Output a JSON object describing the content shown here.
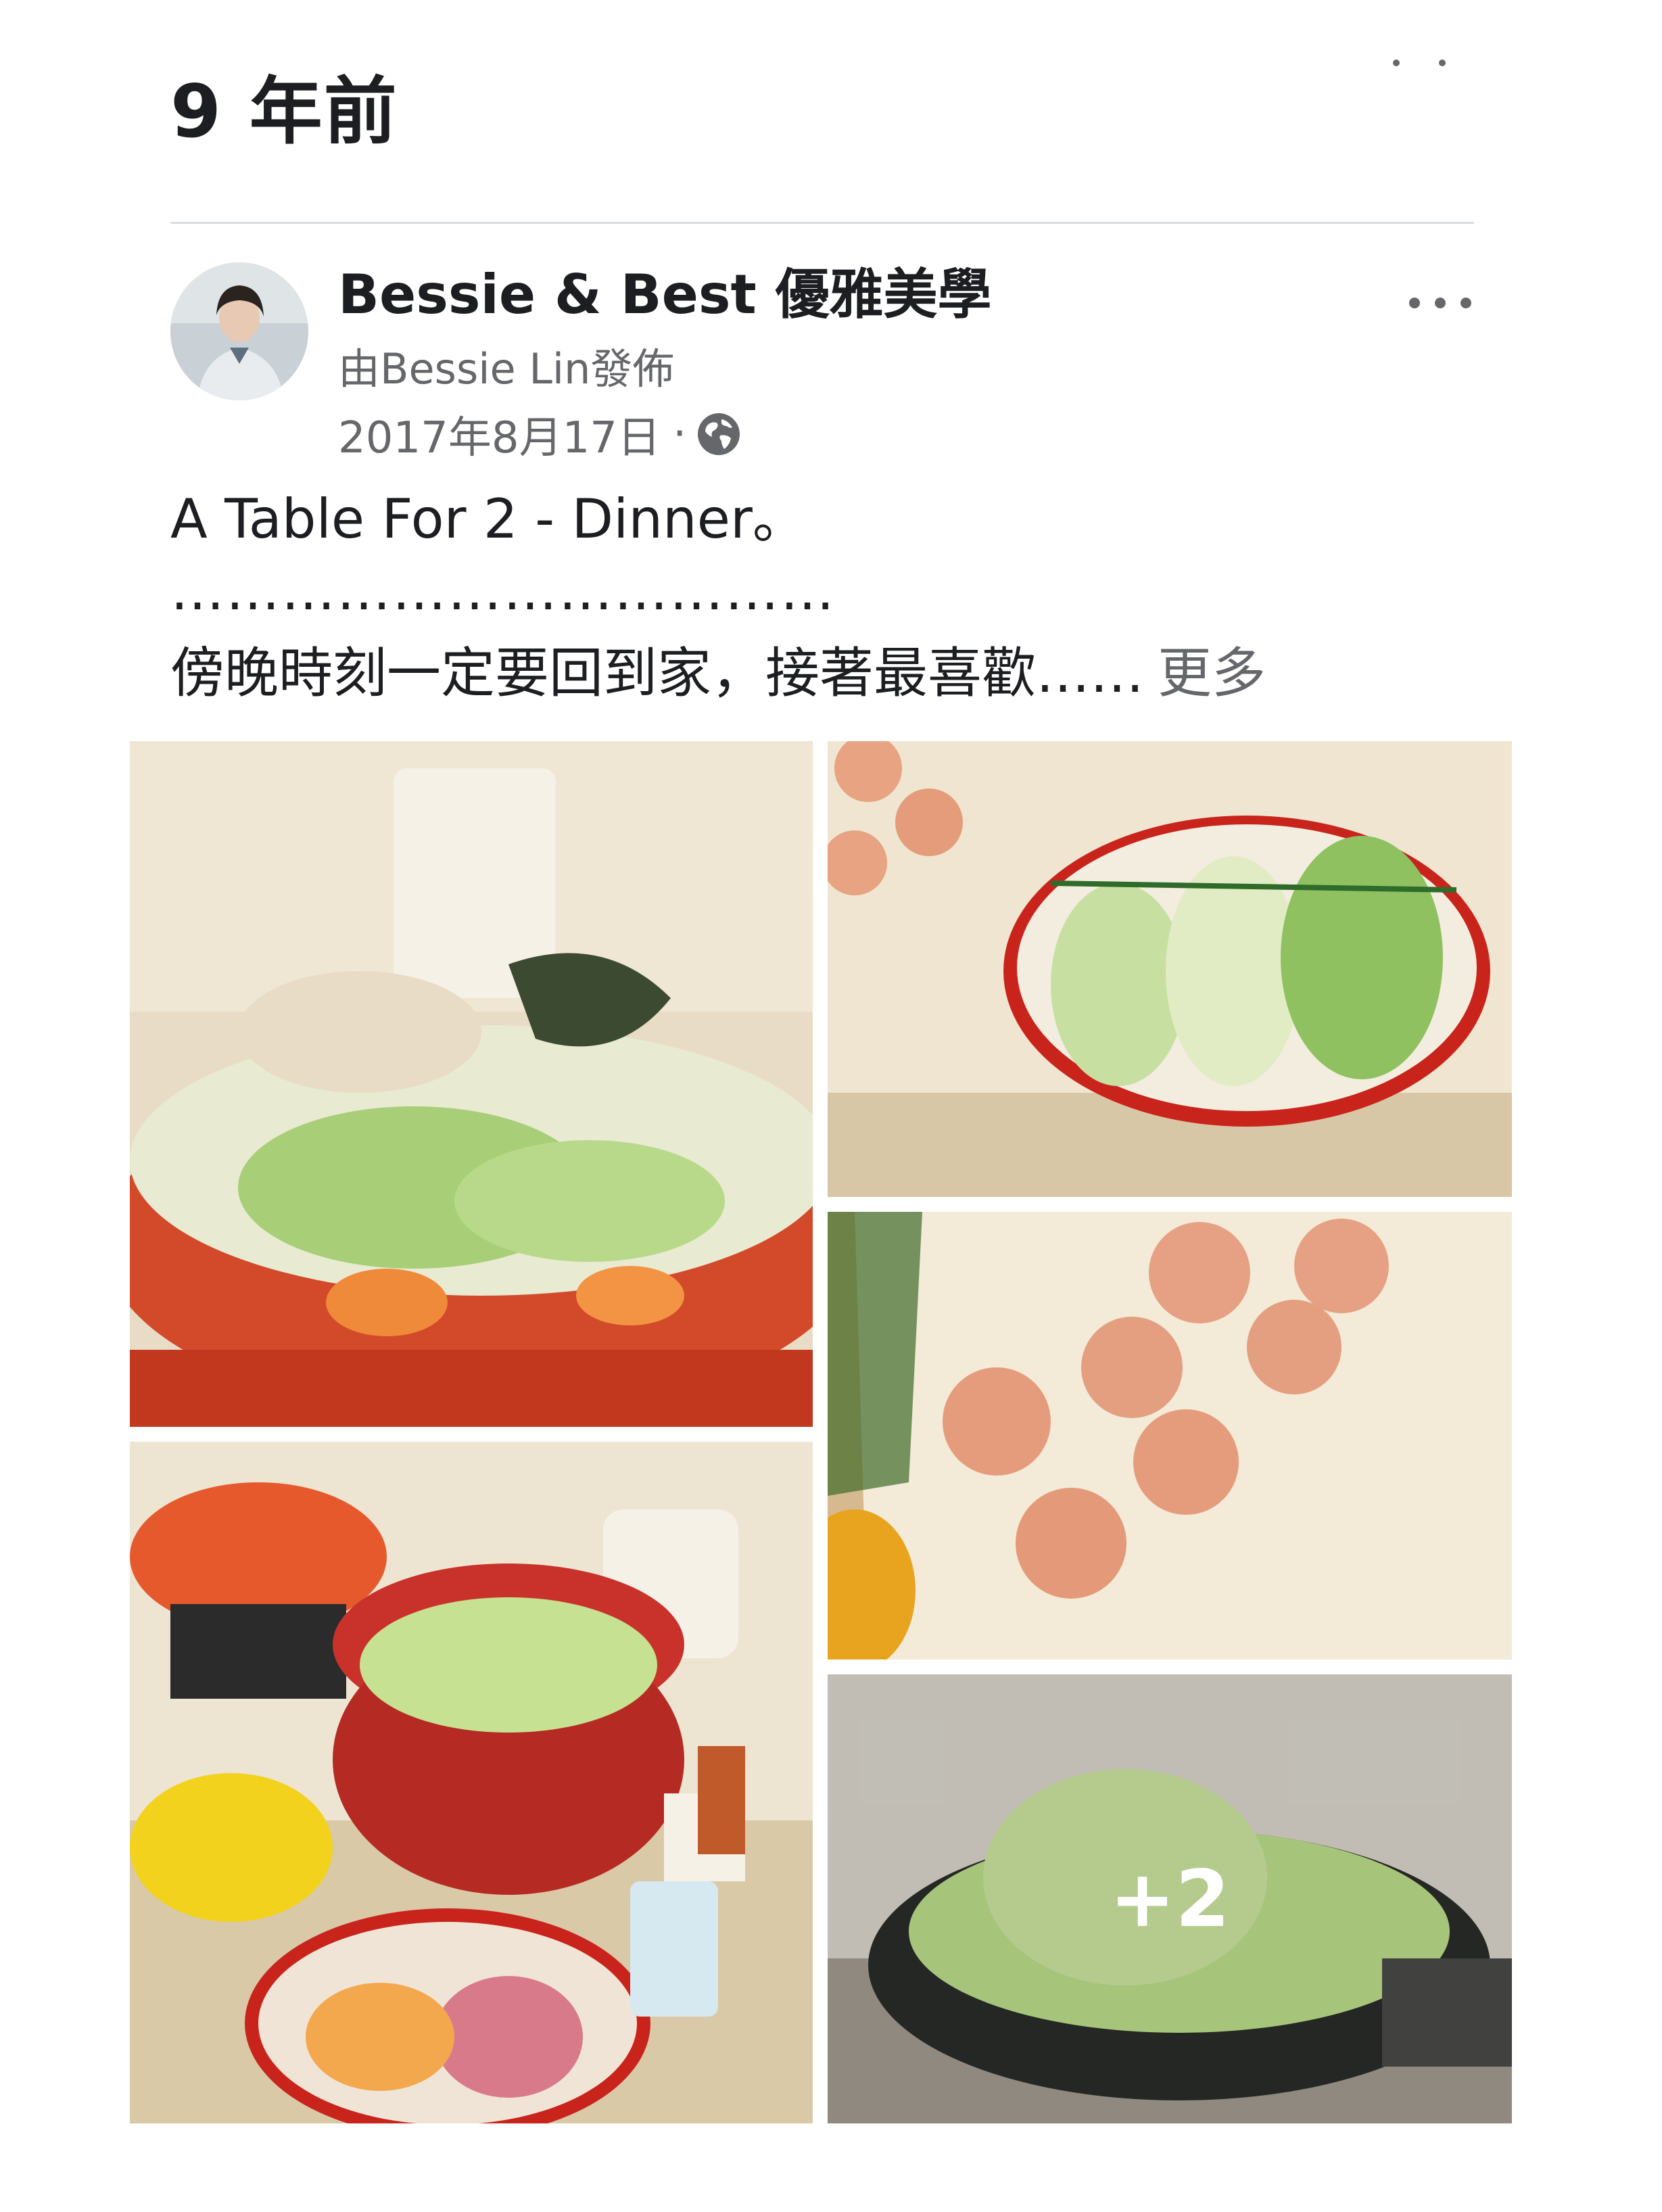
{
  "section": {
    "title": "9 年前"
  },
  "post": {
    "page_name": "Bessie & Best 優雅美學",
    "posted_by": "由Bessie Lin發佈",
    "date": "2017年8月17日",
    "separator": "·",
    "privacy_icon": "globe-icon",
    "more_icon": "more-horizontal-icon",
    "text_line_1": "A Table For 2 - Dinner。",
    "text_line_2": "………………………………",
    "text_line_3": "傍晚時刻一定要回到家，接著最喜歡……",
    "see_more": "更多"
  },
  "photos": {
    "extra_count": "+2",
    "items": [
      "hot-pot-photo",
      "cabbage-rolls-photo",
      "meatballs-photo",
      "ingredients-photo",
      "cabbage-wok-photo"
    ]
  },
  "colors": {
    "secondary_text": "#65676b",
    "primary_text": "#1c1e21",
    "divider": "#dadde1"
  }
}
